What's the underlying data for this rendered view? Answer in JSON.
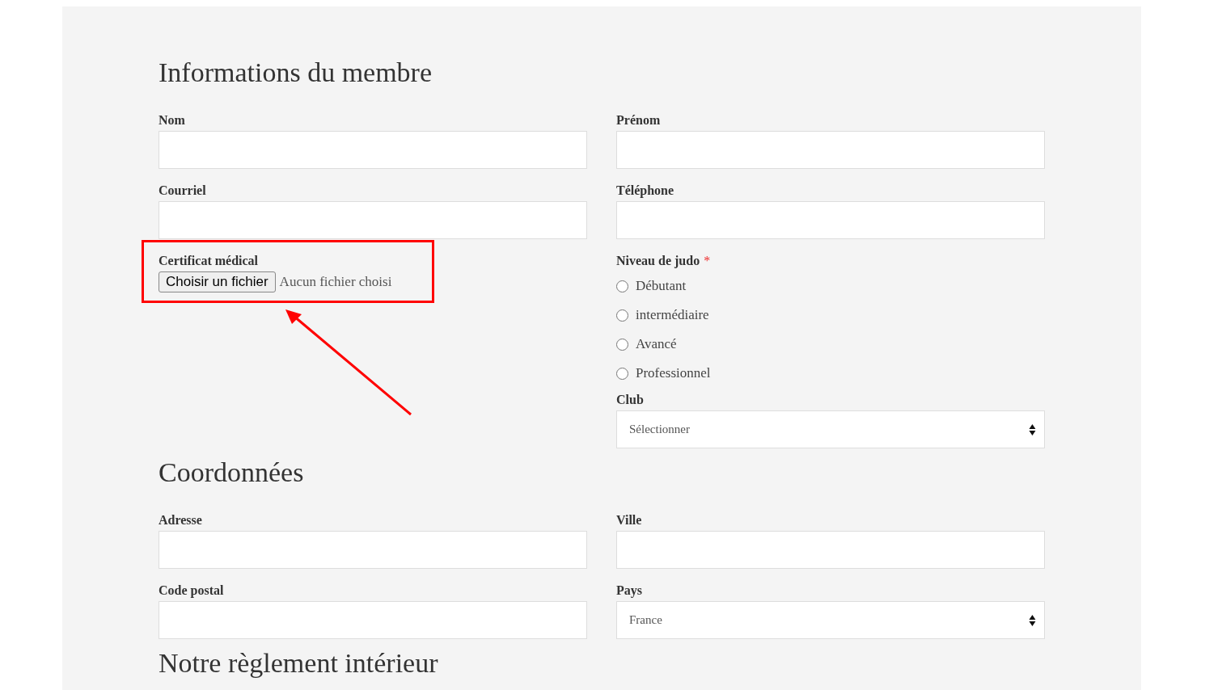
{
  "sections": [
    {
      "heading": "Informations du membre",
      "columns": [
        [
          {
            "kind": "text",
            "label": "Nom"
          },
          {
            "kind": "text",
            "label": "Courriel"
          },
          {
            "kind": "file",
            "label": "Certificat médical",
            "button": "Choisir un fichier",
            "status": "Aucun fichier choisi",
            "highlighted": true
          }
        ],
        [
          {
            "kind": "text",
            "label": "Prénom"
          },
          {
            "kind": "text",
            "label": "Téléphone"
          },
          {
            "kind": "radio",
            "label": "Niveau de judo",
            "required_mark": "*",
            "options": [
              {
                "label": "Débutant",
                "selected": false
              },
              {
                "label": "intermédiaire",
                "selected": false
              },
              {
                "label": "Avancé",
                "selected": false
              },
              {
                "label": "Professionnel",
                "selected": false
              }
            ]
          },
          {
            "kind": "select",
            "label": "Club",
            "value": "Sélectionner"
          }
        ]
      ]
    },
    {
      "heading": "Coordonnées",
      "columns": [
        [
          {
            "kind": "text",
            "label": "Adresse"
          },
          {
            "kind": "text",
            "label": "Code postal"
          }
        ],
        [
          {
            "kind": "text",
            "label": "Ville"
          },
          {
            "kind": "select",
            "label": "Pays",
            "value": "France"
          }
        ]
      ]
    },
    {
      "heading": "Notre règlement intérieur"
    }
  ]
}
